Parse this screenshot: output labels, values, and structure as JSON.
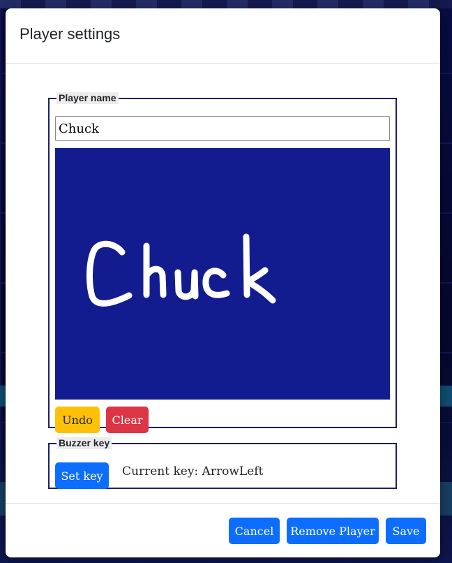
{
  "dialog": {
    "title": "Player settings"
  },
  "player_name": {
    "legend": "Player name",
    "value": "Chuck",
    "signature_text": "Chuck",
    "canvas_color": "#131c8f",
    "ink_color": "#ffffff",
    "undo_label": "Undo",
    "clear_label": "Clear"
  },
  "buzzer_key": {
    "legend": "Buzzer key",
    "set_key_label": "Set key",
    "current_key_text": "Current key: ArrowLeft"
  },
  "footer": {
    "cancel_label": "Cancel",
    "remove_label": "Remove Player",
    "save_label": "Save"
  },
  "colors": {
    "primary": "#0d6efd",
    "warning": "#ffc107",
    "danger": "#dc3545",
    "fieldset_border": "#1b1f6b"
  }
}
